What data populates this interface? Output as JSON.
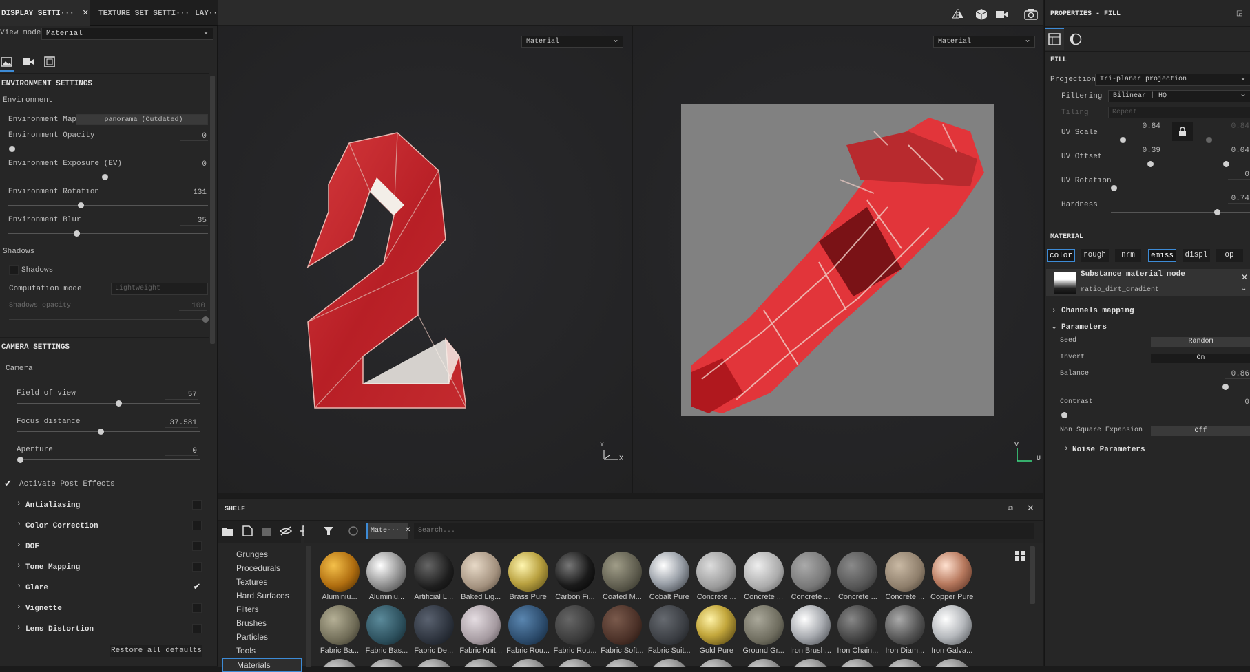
{
  "left_panel": {
    "tabs": [
      "DISPLAY SETTI···",
      "TEXTURE SET SETTI···",
      "LAY···"
    ],
    "view_mode_label": "View mode",
    "view_mode_value": "Material",
    "environment_settings": "ENVIRONMENT SETTINGS",
    "environment": "Environment",
    "env_map_label": "Environment Map",
    "env_map_value": "panorama (Outdated)",
    "sliders": [
      {
        "label": "Environment Opacity",
        "value": "0",
        "fraction": 0.0
      },
      {
        "label": "Environment Exposure (EV)",
        "value": "0",
        "fraction": 0.5
      },
      {
        "label": "Environment Rotation",
        "value": "131",
        "fraction": 0.37
      },
      {
        "label": "Environment Blur",
        "value": "35",
        "fraction": 0.35
      }
    ],
    "shadows_section": "Shadows",
    "shadows_checkbox": "Shadows",
    "computation_mode_label": "Computation mode",
    "computation_mode_value": "Lightweight",
    "shadows_opacity_label": "Shadows opacity",
    "shadows_opacity_value": "100",
    "camera_settings": "CAMERA SETTINGS",
    "camera": "Camera",
    "camera_sliders": [
      {
        "label": "Field of view",
        "value": "57",
        "fraction": 0.55
      },
      {
        "label": "Focus distance",
        "value": "37.581",
        "fraction": 0.45
      },
      {
        "label": "Aperture",
        "value": "0",
        "fraction": 0.0
      }
    ],
    "post_effects": "Activate Post Effects",
    "effects": [
      {
        "label": "Antialiasing",
        "checked": false
      },
      {
        "label": "Color Correction",
        "checked": false
      },
      {
        "label": "DOF",
        "checked": false
      },
      {
        "label": "Tone Mapping",
        "checked": false
      },
      {
        "label": "Glare",
        "checked": true
      },
      {
        "label": "Vignette",
        "checked": false
      },
      {
        "label": "Lens Distortion",
        "checked": false
      }
    ],
    "restore": "Restore all defaults"
  },
  "viewport": {
    "left_mode": "Material",
    "right_mode": "Material",
    "axis_y": "Y",
    "axis_x": "X",
    "axis_v": "V",
    "axis_u": "U"
  },
  "shelf": {
    "title": "SHELF",
    "filter_tag": "Mate···",
    "search_placeholder": "Search...",
    "categories": [
      "Grunges",
      "Procedurals",
      "Textures",
      "Hard Surfaces",
      "Filters",
      "Brushes",
      "Particles",
      "Tools",
      "Materials"
    ],
    "active_category": "Materials",
    "materials_row1": [
      "Aluminiu...",
      "Aluminiu...",
      "Artificial L...",
      "Baked Lig...",
      "Brass Pure",
      "Carbon Fi...",
      "Coated M...",
      "Cobalt Pure",
      "Concrete ...",
      "Concrete ...",
      "Concrete ...",
      "Concrete ...",
      "Concrete ...",
      "Copper Pure"
    ],
    "materials_row2": [
      "Fabric Ba...",
      "Fabric Bas...",
      "Fabric De...",
      "Fabric Knit...",
      "Fabric Rou...",
      "Fabric Rou...",
      "Fabric Soft...",
      "Fabric Suit...",
      "Gold Pure",
      "Ground Gr...",
      "Iron Brush...",
      "Iron Chain...",
      "Iron Diam...",
      "Iron Galva..."
    ]
  },
  "properties": {
    "title": "PROPERTIES - FILL",
    "fill": "FILL",
    "projection_label": "Projection",
    "projection_value": "Tri-planar projection",
    "filtering_label": "Filtering",
    "filtering_value": "Bilinear | HQ",
    "tiling_label": "Tiling",
    "tiling_value": "Repeat",
    "uv_scale_label": "UV Scale",
    "uv_scale_value": "0.84",
    "uv_scale_value2": "0.84",
    "uv_scale_fraction": 0.2,
    "uv_offset_label": "UV Offset",
    "uv_offset_value": "0.39",
    "uv_offset_value2": "0.04",
    "uv_offset_fraction": 0.66,
    "uv_rotation_label": "UV Rotation",
    "uv_rotation_value": "0",
    "hardness_label": "Hardness",
    "hardness_value": "0.74",
    "hardness_fraction": 0.76,
    "material": "MATERIAL",
    "channels": [
      "color",
      "rough",
      "nrm",
      "emiss",
      "displ",
      "op"
    ],
    "substance_mode": "Substance material mode",
    "substance_name": "ratio_dirt_gradient",
    "channels_mapping": "Channels mapping",
    "parameters": "Parameters",
    "seed_label": "Seed",
    "seed_value": "Random",
    "invert_label": "Invert",
    "invert_value": "On",
    "balance_label": "Balance",
    "balance_value": "0.86",
    "contrast_label": "Contrast",
    "contrast_value": "0",
    "nse_label": "Non Square Expansion",
    "nse_value": "Off",
    "noise_parameters": "Noise Parameters"
  }
}
